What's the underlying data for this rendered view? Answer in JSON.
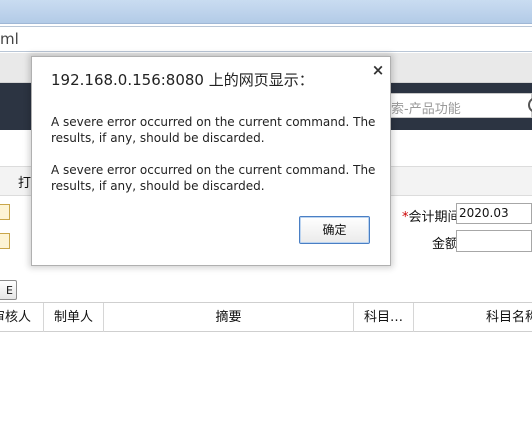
{
  "browser": {
    "address_fragment": "ml"
  },
  "app": {
    "search_placeholder": "索-产品功能",
    "print_menu": "打",
    "period_label": "会计期间",
    "period_required": "*",
    "period_marker": ")",
    "period_value": "2020.03",
    "amount_label": "金额",
    "small_button_label": "E"
  },
  "grid": {
    "columns": [
      "审核人",
      "制单人",
      "摘要",
      "科目…",
      "科目名称"
    ]
  },
  "dialog": {
    "title": "192.168.0.156:8080 上的网页显示：",
    "close_label": "×",
    "messages": [
      "A severe error occurred on the current command.  The results, if any, should be discarded.",
      "A severe error occurred on the current command.  The results, if any, should be discarded."
    ],
    "ok_label": "确定"
  },
  "colors": {
    "header_bg": "#2c3442",
    "required_red": "#cc0000",
    "ok_border": "#4a7fc4"
  }
}
